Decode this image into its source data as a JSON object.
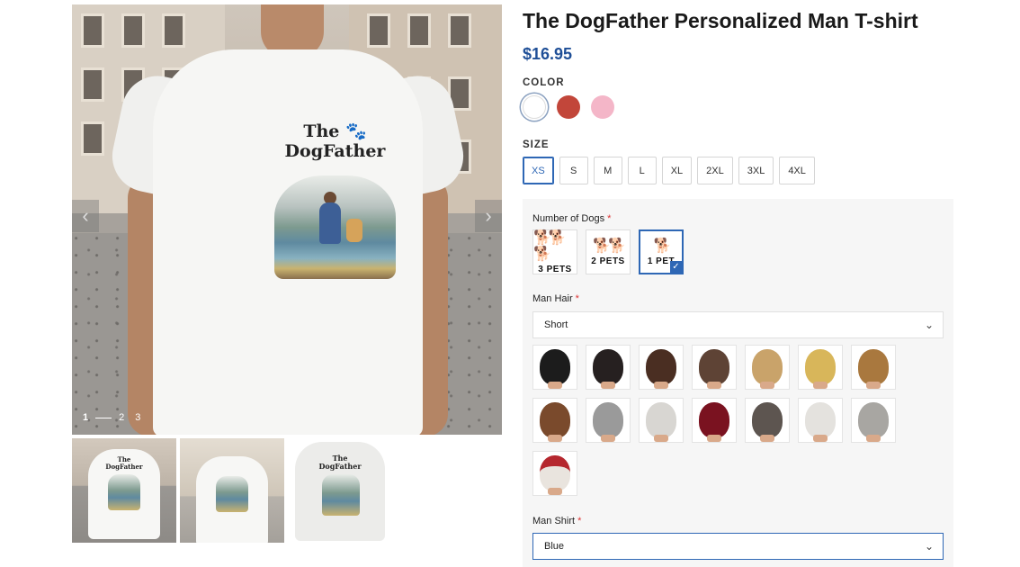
{
  "gallery": {
    "print_title_line1": "The",
    "print_title_line2": "DogFather",
    "prev_icon": "‹",
    "next_icon": "›",
    "pages": [
      "1",
      "2",
      "3"
    ],
    "thumbnails": [
      "thumb-1",
      "thumb-2",
      "thumb-3"
    ]
  },
  "product": {
    "title": "The DogFather Personalized Man T-shirt",
    "price": "$16.95",
    "color_label": "COLOR",
    "colors": [
      "#ffffff",
      "#c2463a",
      "#f4b6c8"
    ],
    "selected_color_index": 0,
    "size_label": "SIZE",
    "sizes": [
      "XS",
      "S",
      "M",
      "L",
      "XL",
      "2XL",
      "3XL",
      "4XL"
    ],
    "selected_size_index": 0
  },
  "options": {
    "dogs_label": "Number of Dogs",
    "required_mark": "*",
    "dogs": [
      {
        "icon": "🐕🐕🐕",
        "label": "3 PETS"
      },
      {
        "icon": "🐕🐕",
        "label": "2 PETS"
      },
      {
        "icon": "🐕",
        "label": "1 PET"
      }
    ],
    "selected_dog_index": 2,
    "check_icon": "✓",
    "hair_label": "Man Hair",
    "hair_value": "Short",
    "hair_colors": [
      "#1c1c1c",
      "#262020",
      "#4a2e22",
      "#5e4335",
      "#c9a36a",
      "#d8b65a",
      "#a9783e",
      "#7a4a2c",
      "#9a9a9a",
      "#d8d6d2",
      "#7a1220",
      "#5d5550",
      "#e4e2de",
      "#a8a6a2",
      "#b5272e"
    ],
    "shirt_label": "Man Shirt",
    "shirt_value": "Blue",
    "chevron_icon": "⌄"
  }
}
